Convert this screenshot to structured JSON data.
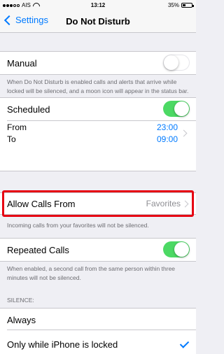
{
  "status_bar": {
    "carrier": "AIS",
    "time": "13:12",
    "battery": "35%",
    "battery_level": 0.35
  },
  "nav": {
    "back_label": "Settings",
    "title": "Do Not Disturb"
  },
  "manual": {
    "label": "Manual",
    "enabled": false,
    "footer": "When Do Not Disturb is enabled calls and alerts that arrive while locked will be silenced, and a moon icon will appear in the status bar."
  },
  "scheduled": {
    "label": "Scheduled",
    "enabled": true,
    "from_label": "From",
    "to_label": "To",
    "from_time": "23:00",
    "to_time": "09:00"
  },
  "allow_calls": {
    "label": "Allow Calls From",
    "value": "Favorites",
    "footer": "Incoming calls from your favorites will not be silenced."
  },
  "repeated_calls": {
    "label": "Repeated Calls",
    "enabled": true,
    "footer": "When enabled, a second call from the same person within three minutes will not be silenced."
  },
  "silence": {
    "header": "SILENCE:",
    "options": [
      "Always",
      "Only while iPhone is locked"
    ],
    "selected": "Only while iPhone is locked"
  },
  "colors": {
    "accent": "#007aff",
    "toggle_on": "#4cd964",
    "highlight": "#e60012"
  }
}
